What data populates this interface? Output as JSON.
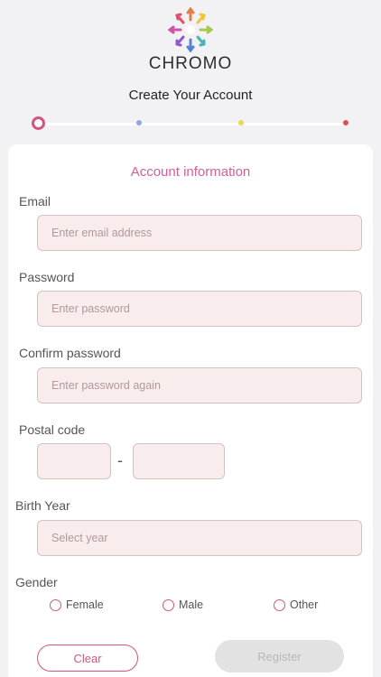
{
  "header": {
    "brand": "CHROMO",
    "title": "Create Your Account"
  },
  "stepper": {
    "current_step": 1,
    "total_steps": 4,
    "colors": [
      "#d4547f",
      "#8ea7e0",
      "#ecd84a",
      "#dd5151"
    ]
  },
  "form": {
    "section_title": "Account information",
    "email": {
      "label": "Email",
      "placeholder": "Enter email address"
    },
    "password": {
      "label": "Password",
      "placeholder": "Enter password"
    },
    "confirm_password": {
      "label": "Confirm password",
      "placeholder": "Enter password again"
    },
    "postal_code": {
      "label": "Postal code",
      "separator": "-"
    },
    "birth_year": {
      "label": "Birth Year",
      "placeholder": "Select year"
    },
    "gender": {
      "label": "Gender",
      "options": [
        "Female",
        "Male",
        "Other"
      ]
    }
  },
  "buttons": {
    "clear": "Clear",
    "register": "Register"
  },
  "colors": {
    "accent": "#d4547f",
    "field_bg": "#f9ecec",
    "disabled_bg": "#e2e2e2"
  }
}
